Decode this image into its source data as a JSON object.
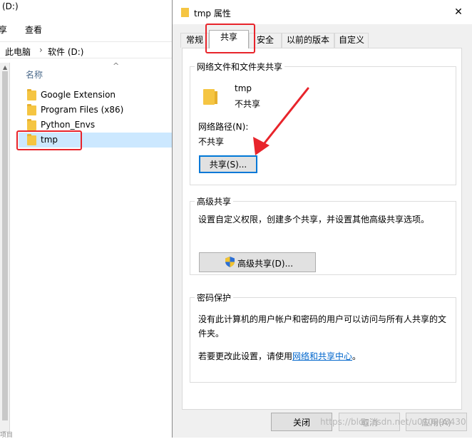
{
  "explorer": {
    "title_fragment": "(D:)",
    "ribbon_tabs": [
      "享",
      "查看"
    ],
    "breadcrumb": [
      "此电脑",
      "软件 (D:)"
    ],
    "column_header": "名称",
    "items": [
      {
        "label": "Google Extension",
        "selected": false
      },
      {
        "label": "Program Files (x86)",
        "selected": false
      },
      {
        "label": "Python_Envs",
        "selected": false
      },
      {
        "label": "tmp",
        "selected": true
      }
    ],
    "nav_bottom_fragment": "项目"
  },
  "dialog": {
    "title": "tmp 属性",
    "close_glyph": "✕",
    "tabs": [
      {
        "label": "常规",
        "active": false
      },
      {
        "label": "共享",
        "active": true
      },
      {
        "label": "安全",
        "active": false
      },
      {
        "label": "以前的版本",
        "active": false
      },
      {
        "label": "自定义",
        "active": false
      }
    ],
    "network_share": {
      "caption": "网络文件和文件夹共享",
      "folder_name": "tmp",
      "share_status": "不共享",
      "path_label": "网络路径(N):",
      "path_value": "不共享",
      "share_button": "共享(S)..."
    },
    "advanced_share": {
      "caption": "高级共享",
      "description": "设置自定义权限，创建多个共享，并设置其他高级共享选项。",
      "button": "高级共享(D)..."
    },
    "password_protection": {
      "caption": "密码保护",
      "description": "没有此计算机的用户帐户和密码的用户可以访问与所有人共享的文件夹。",
      "change_prefix": "若要更改此设置，请使用",
      "link": "网络和共享中心",
      "change_suffix": "。"
    },
    "buttons": {
      "close": "关闭",
      "cancel": "取消",
      "apply": "应用(A)"
    }
  },
  "annotation_color": "#e8242b",
  "accent_color": "#0078d7",
  "watermark": "https://blog.csdn.net/u010993430"
}
